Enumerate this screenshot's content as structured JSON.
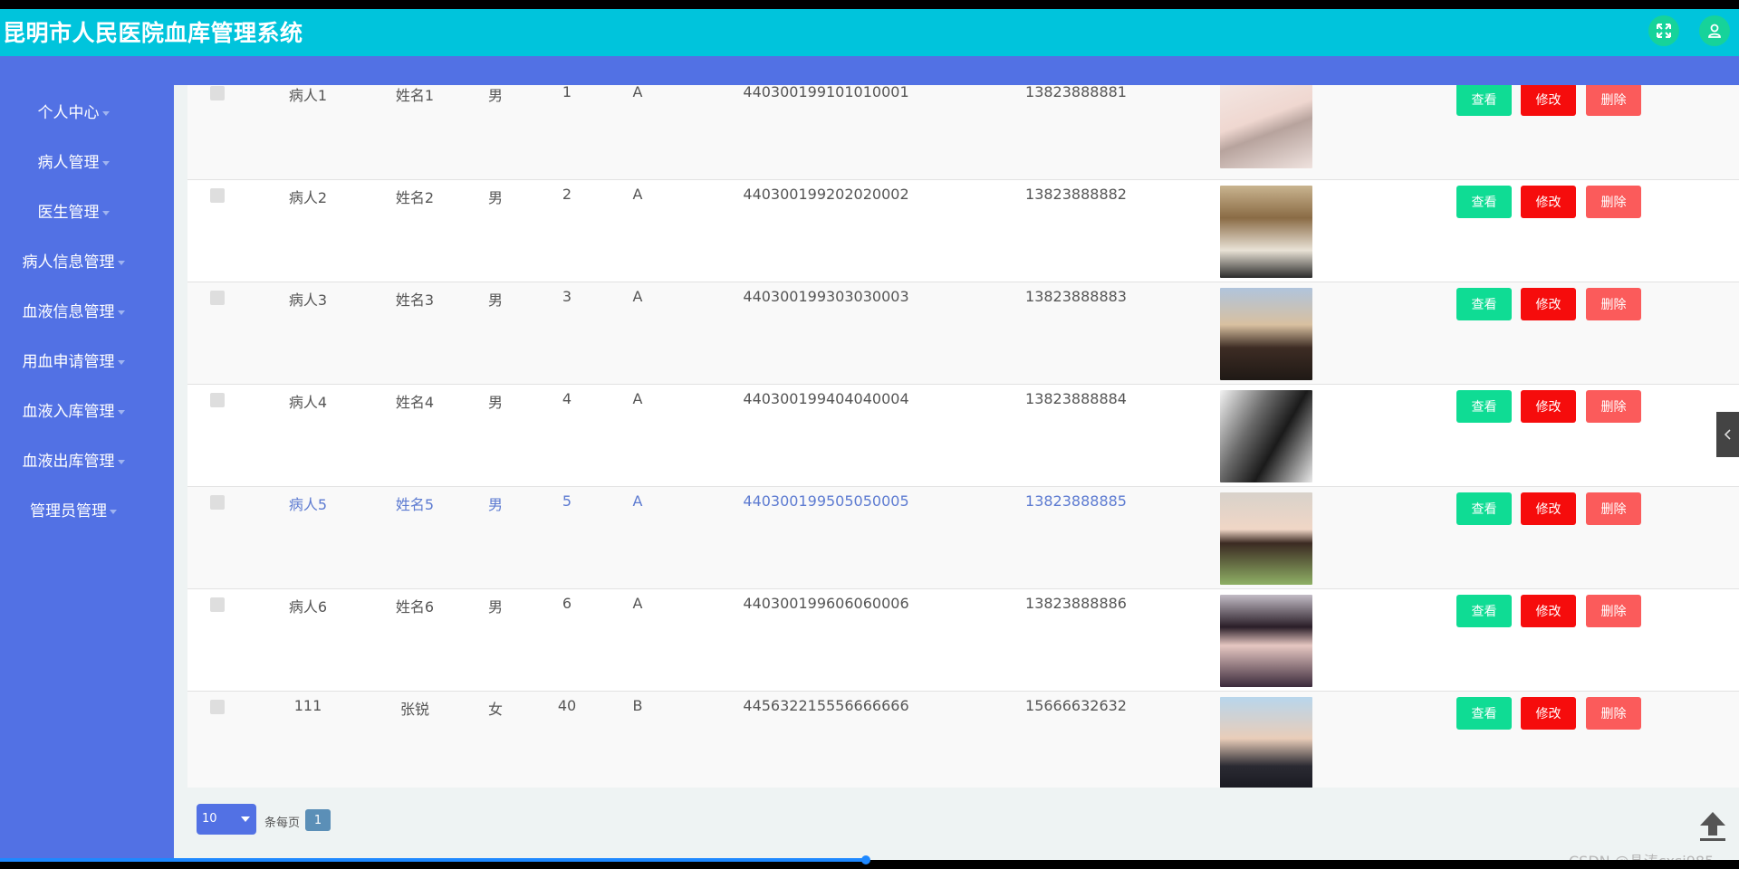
{
  "header": {
    "title": "昆明市人民医院血库管理系统"
  },
  "nav": [
    {
      "label": "个人中心"
    },
    {
      "label": "病人管理"
    },
    {
      "label": "医生管理"
    },
    {
      "label": "病人信息管理"
    },
    {
      "label": "血液信息管理"
    },
    {
      "label": "用血申请管理"
    },
    {
      "label": "血液入库管理"
    },
    {
      "label": "血液出库管理"
    },
    {
      "label": "管理员管理"
    }
  ],
  "rows": [
    {
      "account": "病人1",
      "name": "姓名1",
      "gender": "男",
      "age": "1",
      "blood": "A",
      "id_card": "440300199101010001",
      "phone": "13823888881"
    },
    {
      "account": "病人2",
      "name": "姓名2",
      "gender": "男",
      "age": "2",
      "blood": "A",
      "id_card": "440300199202020002",
      "phone": "13823888882"
    },
    {
      "account": "病人3",
      "name": "姓名3",
      "gender": "男",
      "age": "3",
      "blood": "A",
      "id_card": "440300199303030003",
      "phone": "13823888883"
    },
    {
      "account": "病人4",
      "name": "姓名4",
      "gender": "男",
      "age": "4",
      "blood": "A",
      "id_card": "440300199404040004",
      "phone": "13823888884"
    },
    {
      "account": "病人5",
      "name": "姓名5",
      "gender": "男",
      "age": "5",
      "blood": "A",
      "id_card": "440300199505050005",
      "phone": "13823888885"
    },
    {
      "account": "病人6",
      "name": "姓名6",
      "gender": "男",
      "age": "6",
      "blood": "A",
      "id_card": "440300199606060006",
      "phone": "13823888886"
    },
    {
      "account": "111",
      "name": "张锐",
      "gender": "女",
      "age": "40",
      "blood": "B",
      "id_card": "445632215556666666",
      "phone": "15666632632"
    }
  ],
  "actions": {
    "view": "查看",
    "edit": "修改",
    "delete": "删除"
  },
  "pager": {
    "page_size": "10",
    "per_page_label": "条每页",
    "current_page": "1"
  },
  "watermark": "CSDN @晶涛cxsj985",
  "icons": {
    "fullscreen": "fullscreen-icon",
    "user": "user-icon",
    "back_to_top": "back-to-top-icon",
    "collapse": "chevron-left-icon"
  },
  "colors": {
    "header": "#00c4dc",
    "sidebar": "#5271e4",
    "view": "#0fdc94",
    "edit": "#f60c0c",
    "delete": "#fb5b5b",
    "highlight": "#5d7bd1"
  }
}
